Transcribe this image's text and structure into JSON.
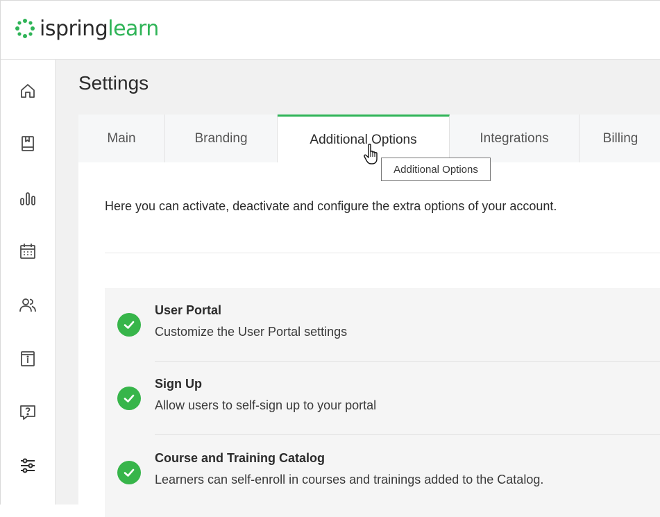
{
  "app": {
    "logo_part1": "ispring",
    "logo_part2": "learn"
  },
  "sidebar": {
    "items": [
      {
        "icon": "home-icon"
      },
      {
        "icon": "book-icon"
      },
      {
        "icon": "bar-chart-icon"
      },
      {
        "icon": "calendar-icon"
      },
      {
        "icon": "users-icon"
      },
      {
        "icon": "info-icon"
      },
      {
        "icon": "help-icon"
      },
      {
        "icon": "settings-sliders-icon",
        "active": true
      }
    ]
  },
  "page": {
    "title": "Settings"
  },
  "tabs": [
    {
      "label": "Main"
    },
    {
      "label": "Branding"
    },
    {
      "label": "Additional Options",
      "active": true
    },
    {
      "label": "Integrations"
    },
    {
      "label": "Billing"
    }
  ],
  "tooltip": {
    "text": "Additional Options"
  },
  "intro_text": "Here you can activate, deactivate and configure the extra options of your account.",
  "options": [
    {
      "title": "User Portal",
      "description": "Customize the User Portal settings",
      "enabled": true
    },
    {
      "title": "Sign Up",
      "description": "Allow users to self-sign up to your portal",
      "enabled": true
    },
    {
      "title": "Course and Training Catalog",
      "description": "Learners can self-enroll in courses and trainings added to the Catalog.",
      "enabled": true
    }
  ],
  "colors": {
    "accent": "#2fb457",
    "check": "#37b54a",
    "icon": "#4a4a4a"
  }
}
